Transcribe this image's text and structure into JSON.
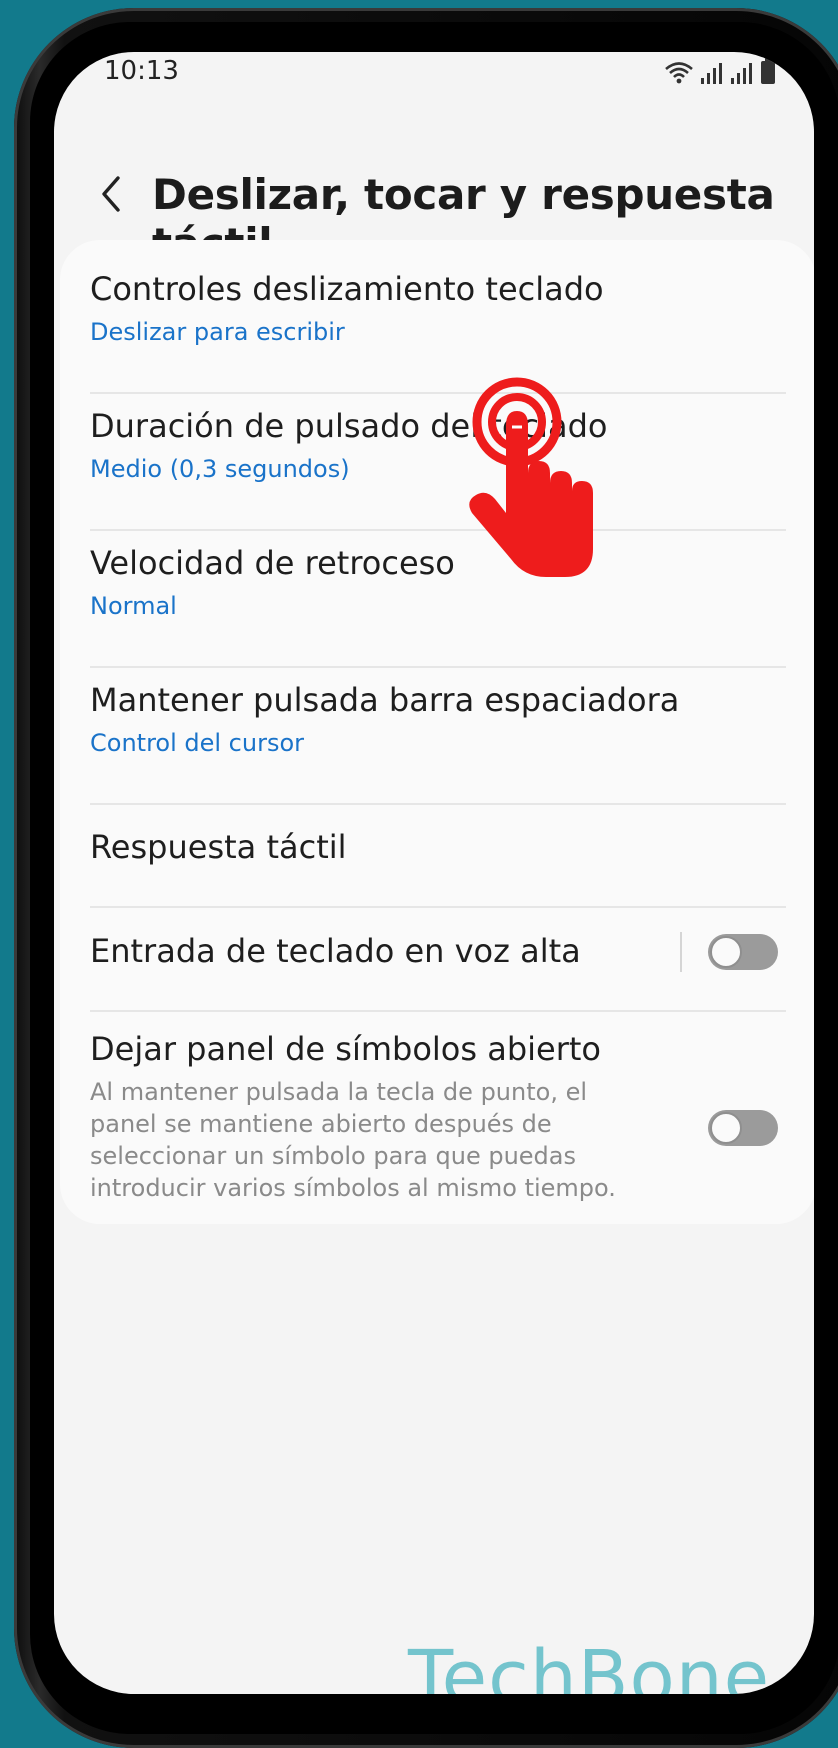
{
  "status_bar": {
    "time": "10:13",
    "icons": [
      "wifi-icon",
      "signal-icon",
      "signal-icon",
      "battery-icon"
    ]
  },
  "header": {
    "back_icon": "chevron-left-icon",
    "title": "Deslizar, tocar y respuesta táctil"
  },
  "settings": {
    "items": [
      {
        "title": "Controles deslizamiento teclado",
        "subtitle": "Deslizar para escribir"
      },
      {
        "title": "Duración de pulsado del teclado",
        "subtitle": "Medio (0,3 segundos)"
      },
      {
        "title": "Velocidad de retroceso",
        "subtitle": "Normal"
      },
      {
        "title": "Mantener pulsada barra espaciadora",
        "subtitle": "Control del cursor"
      },
      {
        "title": "Respuesta táctil"
      },
      {
        "title": "Entrada de teclado en voz alta",
        "toggle": false
      },
      {
        "title": "Dejar panel de símbolos abierto",
        "description": "Al mantener pulsada la tecla de punto, el panel se mantiene abierto después de seleccionar un símbolo para que puedas introducir varios símbolos al mismo tiempo.",
        "toggle": false
      }
    ]
  },
  "overlay": {
    "pointer_icon": "tap-hand-icon",
    "color": "#ee1c1c"
  },
  "watermark": "TechBone",
  "colors": {
    "accent": "#1a73c9",
    "background": "#127a8c",
    "watermark": "#74c4cd"
  }
}
